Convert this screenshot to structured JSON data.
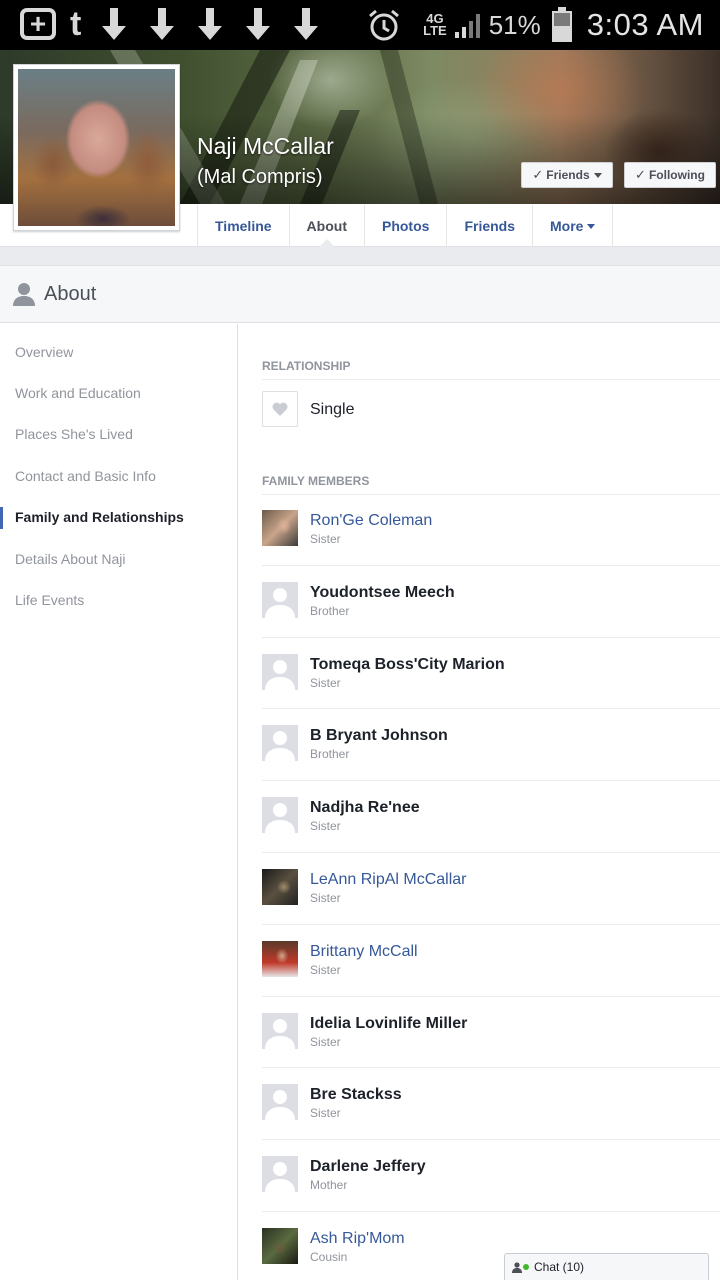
{
  "status_bar": {
    "network": "4G",
    "network_sub": "LTE",
    "battery_percent": "51%",
    "time": "3:03 AM",
    "icons": [
      "add-box-icon",
      "tumblr-icon",
      "download-icon",
      "download-icon",
      "download-icon",
      "download-icon",
      "download-icon",
      "alarm-icon",
      "signal-icon",
      "battery-icon"
    ]
  },
  "profile": {
    "name": "Naji McCallar",
    "alternate_name": "(Mal Compris)",
    "friends_button": "Friends",
    "following_button": "Following"
  },
  "tabs": [
    {
      "label": "Timeline",
      "active": false
    },
    {
      "label": "About",
      "active": true
    },
    {
      "label": "Photos",
      "active": false
    },
    {
      "label": "Friends",
      "active": false
    },
    {
      "label": "More",
      "active": false
    }
  ],
  "about": {
    "title": "About",
    "nav": [
      {
        "label": "Overview",
        "active": false
      },
      {
        "label": "Work and Education",
        "active": false
      },
      {
        "label": "Places She's Lived",
        "active": false
      },
      {
        "label": "Contact and Basic Info",
        "active": false
      },
      {
        "label": "Family and Relationships",
        "active": true
      },
      {
        "label": "Details About Naji",
        "active": false
      },
      {
        "label": "Life Events",
        "active": false
      }
    ]
  },
  "relationship": {
    "section_label": "Relationship",
    "status": "Single"
  },
  "family": {
    "section_label": "Family Members",
    "members": [
      {
        "name": "Ron'Ge Coleman",
        "relation": "Sister",
        "linked": true,
        "photo": "a"
      },
      {
        "name": "Youdontsee Meech",
        "relation": "Brother",
        "linked": false,
        "photo": ""
      },
      {
        "name": "Tomeqa Boss'City Marion",
        "relation": "Sister",
        "linked": false,
        "photo": ""
      },
      {
        "name": "B Bryant Johnson",
        "relation": "Brother",
        "linked": false,
        "photo": ""
      },
      {
        "name": "Nadjha Re'nee",
        "relation": "Sister",
        "linked": false,
        "photo": ""
      },
      {
        "name": "LeAnn RipAl McCallar",
        "relation": "Sister",
        "linked": true,
        "photo": "b"
      },
      {
        "name": "Brittany McCall",
        "relation": "Sister",
        "linked": true,
        "photo": "c"
      },
      {
        "name": "Idelia Lovinlife Miller",
        "relation": "Sister",
        "linked": false,
        "photo": ""
      },
      {
        "name": "Bre Stackss",
        "relation": "Sister",
        "linked": false,
        "photo": ""
      },
      {
        "name": "Darlene Jeffery",
        "relation": "Mother",
        "linked": false,
        "photo": ""
      },
      {
        "name": "Ash Rip'Mom",
        "relation": "Cousin",
        "linked": true,
        "photo": "d"
      }
    ]
  },
  "chat": {
    "label": "Chat (10)"
  }
}
